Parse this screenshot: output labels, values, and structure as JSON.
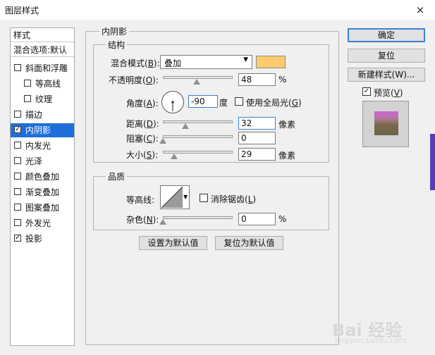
{
  "window": {
    "title": "图层样式",
    "close_glyph": "×"
  },
  "left_list": {
    "header": "样式",
    "blend_options": "混合选项:默认",
    "items": [
      {
        "label": "斜面和浮雕",
        "checked": false
      },
      {
        "label": "等高线",
        "checked": false
      },
      {
        "label": "纹理",
        "checked": false
      },
      {
        "label": "描边",
        "checked": false
      },
      {
        "label": "内阴影",
        "checked": true,
        "selected": true
      },
      {
        "label": "内发光",
        "checked": false
      },
      {
        "label": "光泽",
        "checked": false
      },
      {
        "label": "颜色叠加",
        "checked": false
      },
      {
        "label": "渐变叠加",
        "checked": false
      },
      {
        "label": "图案叠加",
        "checked": false
      },
      {
        "label": "外发光",
        "checked": false
      },
      {
        "label": "投影",
        "checked": true
      }
    ],
    "check_glyph": "✓"
  },
  "inner_shadow": {
    "group_title": "内阴影",
    "structure": {
      "title": "结构",
      "blend_mode_label": "混合模式(",
      "blend_mode_key": "B",
      "blend_mode_suffix": "):",
      "blend_mode_value": "叠加",
      "shadow_color": "#fdcb6e",
      "opacity_label": "不透明度(",
      "opacity_key": "O",
      "opacity_suffix": "):",
      "opacity_value": "48",
      "opacity_fraction": 0.48,
      "opacity_unit": "%",
      "angle_label": "角度(",
      "angle_key": "A",
      "angle_suffix": "):",
      "angle_value": "-90",
      "angle_unit": "度",
      "global_light_label": "使用全局光(",
      "global_light_key": "G",
      "global_light_suffix": ")",
      "distance_label": "距离(",
      "distance_key": "D",
      "distance_suffix": "):",
      "distance_value": "32",
      "distance_unit": "像素",
      "choke_label": "阻塞(",
      "choke_key": "C",
      "choke_suffix": "):",
      "choke_value": "0",
      "size_label": "大小(",
      "size_key": "S",
      "size_suffix": "):",
      "size_value": "29",
      "size_unit": "像素"
    },
    "quality": {
      "title": "品质",
      "contour_label": "等高线:",
      "anti_alias_label": "消除锯齿(",
      "anti_alias_key": "L",
      "anti_alias_suffix": ")",
      "noise_label": "杂色(",
      "noise_key": "N",
      "noise_suffix": "):",
      "noise_value": "0",
      "noise_unit": "%"
    },
    "set_default": "设置为默认值",
    "reset_default": "复位为默认值"
  },
  "right_panel": {
    "ok": "确定",
    "reset": "复位",
    "new_style": "新建样式(W)...",
    "preview_label": "预览(",
    "preview_key": "V",
    "preview_suffix": ")",
    "preview_checked": true
  },
  "watermark": {
    "text": "Bai  经验",
    "sub": "jingyan.baidu.com"
  }
}
